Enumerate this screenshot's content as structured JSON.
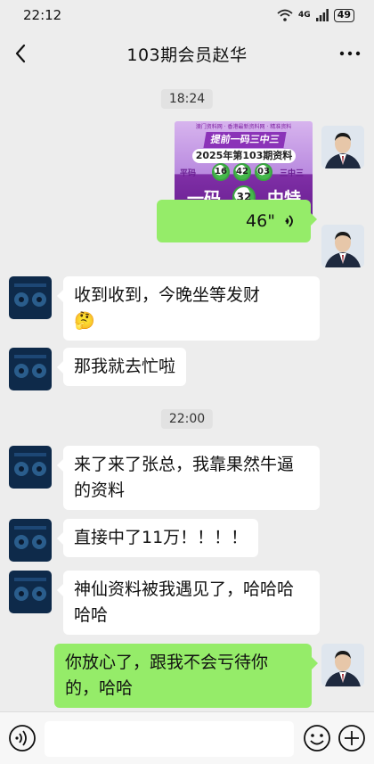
{
  "status_bar": {
    "time": "22:12",
    "network": "4G",
    "battery": "49"
  },
  "header": {
    "title": "103期会员赵华"
  },
  "messages": {
    "time1": "18:24",
    "time2": "22:00",
    "promo": {
      "top_text": "澳门资料网 · 香港最新资料网 · 精准资料",
      "banner": "提前一码三中三",
      "issue": "2025年第103期资料",
      "balls": [
        "16",
        "42",
        "03"
      ],
      "left_label": "平码",
      "right_label": "三中三",
      "bottom_left": "一码",
      "bottom_ball": "32",
      "bottom_right": "中特"
    },
    "voice_duration": "46\"",
    "m1": "收到收到，今晚坐等发财",
    "m1_emoji": "🤔",
    "m2": "那我就去忙啦",
    "m3": "来了来了张总，我靠果然牛逼的资料",
    "m4": "直接中了11万！！！！",
    "m5": "神仙资料被我遇见了，哈哈哈哈哈",
    "m6": "你放心了，跟我不会亏待你的，哈哈"
  },
  "input": {
    "placeholder": ""
  },
  "colors": {
    "background": "#ededed",
    "sent_bubble": "#95ec69",
    "received_bubble": "#ffffff"
  }
}
